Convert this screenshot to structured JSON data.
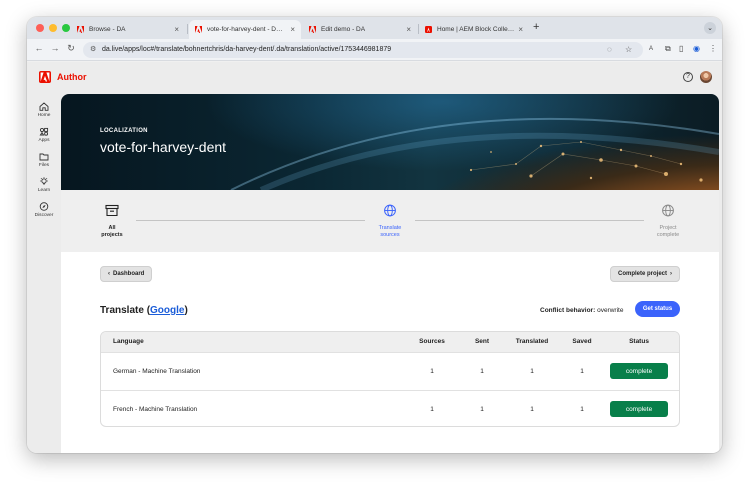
{
  "browser": {
    "tabs": [
      {
        "title": "Browse - DA",
        "active": false
      },
      {
        "title": "vote-for-harvey-dent - DA Tr",
        "active": true
      },
      {
        "title": "Edit demo - DA",
        "active": false
      },
      {
        "title": "Home | AEM Block Collection",
        "active": false
      }
    ],
    "new_tab": "+",
    "url": "da.live/apps/loc#/translate/bohnertchris/da-harvey-dent/.da/translation/active/1753446981879"
  },
  "app": {
    "brand": "Author",
    "brand_color": "#eb1000",
    "nav": [
      {
        "label": "Home",
        "icon": "home-icon"
      },
      {
        "label": "Apps",
        "icon": "apps-icon"
      },
      {
        "label": "Files",
        "icon": "folder-icon"
      },
      {
        "label": "Learn",
        "icon": "lightbulb-icon"
      },
      {
        "label": "Discover",
        "icon": "compass-icon"
      }
    ]
  },
  "hero": {
    "eyebrow": "LOCALIZATION",
    "title": "vote-for-harvey-dent"
  },
  "steps": [
    {
      "label_1": "All",
      "label_2": "projects",
      "state": "done"
    },
    {
      "label_1": "Translate",
      "label_2": "sources",
      "state": "active"
    },
    {
      "label_1": "Project",
      "label_2": "complete",
      "state": "pending"
    }
  ],
  "actions": {
    "dashboard": "Dashboard",
    "complete_project": "Complete project",
    "get_status": "Get status"
  },
  "translate": {
    "prefix": "Translate (",
    "service": "Google",
    "suffix": ")"
  },
  "conflict": {
    "label": "Conflict behavior:",
    "value": "overwrite"
  },
  "table": {
    "headers": [
      "Language",
      "Sources",
      "Sent",
      "Translated",
      "Saved",
      "Status"
    ],
    "rows": [
      {
        "language": "German - Machine Translation",
        "sources": "1",
        "sent": "1",
        "translated": "1",
        "saved": "1",
        "status": "complete"
      },
      {
        "language": "French - Machine Translation",
        "sources": "1",
        "sent": "1",
        "translated": "1",
        "saved": "1",
        "status": "complete"
      }
    ]
  },
  "colors": {
    "accent": "#3b63fb",
    "link": "#1a5cd8",
    "status_complete": "#087f4a"
  }
}
